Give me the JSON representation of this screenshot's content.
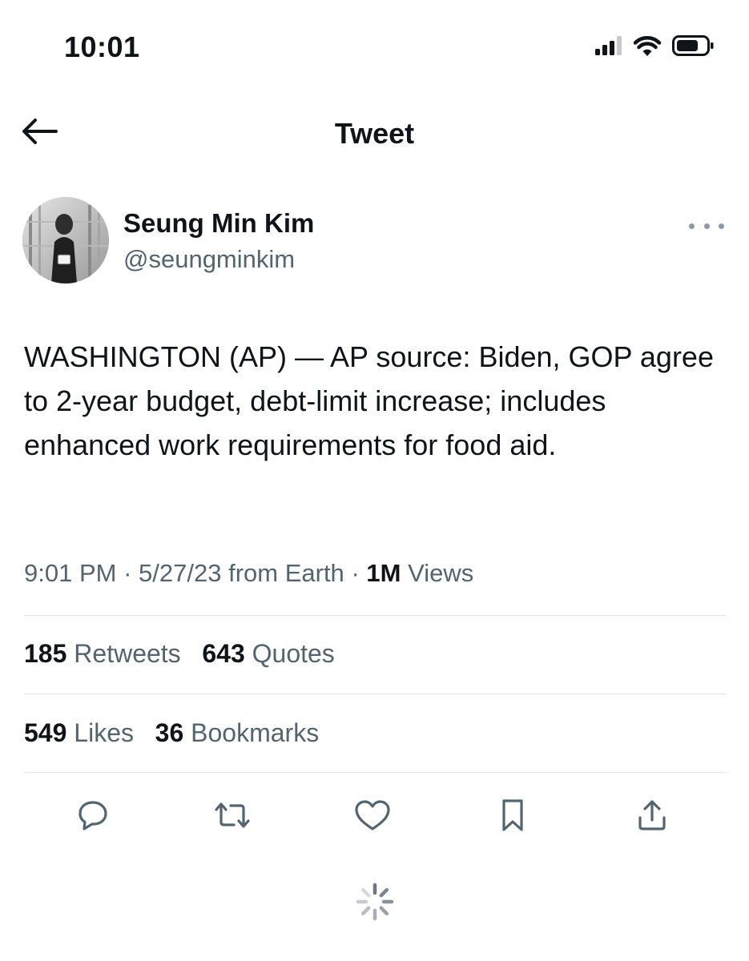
{
  "status_bar": {
    "time": "10:01",
    "icons": [
      "cellular-signal-icon",
      "wifi-icon",
      "battery-icon"
    ]
  },
  "header": {
    "title": "Tweet",
    "back_icon": "arrow-left-icon"
  },
  "author": {
    "name": "Seung Min Kim",
    "handle": "@seungminkim",
    "avatar_icon": "avatar-photo",
    "more_icon": "more-horizontal-icon"
  },
  "tweet": {
    "text": "WASHINGTON (AP) — AP source: Biden, GOP agree to 2-year budget, debt-limit increase; includes enhanced work requirements for food aid.",
    "time": "9:01 PM",
    "date": "5/27/23",
    "source": "from Earth",
    "views_count": "1M",
    "views_label": "Views",
    "separator": "·"
  },
  "stats": {
    "retweets_count": "185",
    "retweets_label": "Retweets",
    "quotes_count": "643",
    "quotes_label": "Quotes",
    "likes_count": "549",
    "likes_label": "Likes",
    "bookmarks_count": "36",
    "bookmarks_label": "Bookmarks"
  },
  "actions": [
    "reply-icon",
    "retweet-icon",
    "like-icon",
    "bookmark-icon",
    "share-icon"
  ],
  "colors": {
    "text_primary": "#0f1419",
    "text_secondary": "#536471",
    "divider": "#e1e5e8",
    "icon": "#536471"
  }
}
